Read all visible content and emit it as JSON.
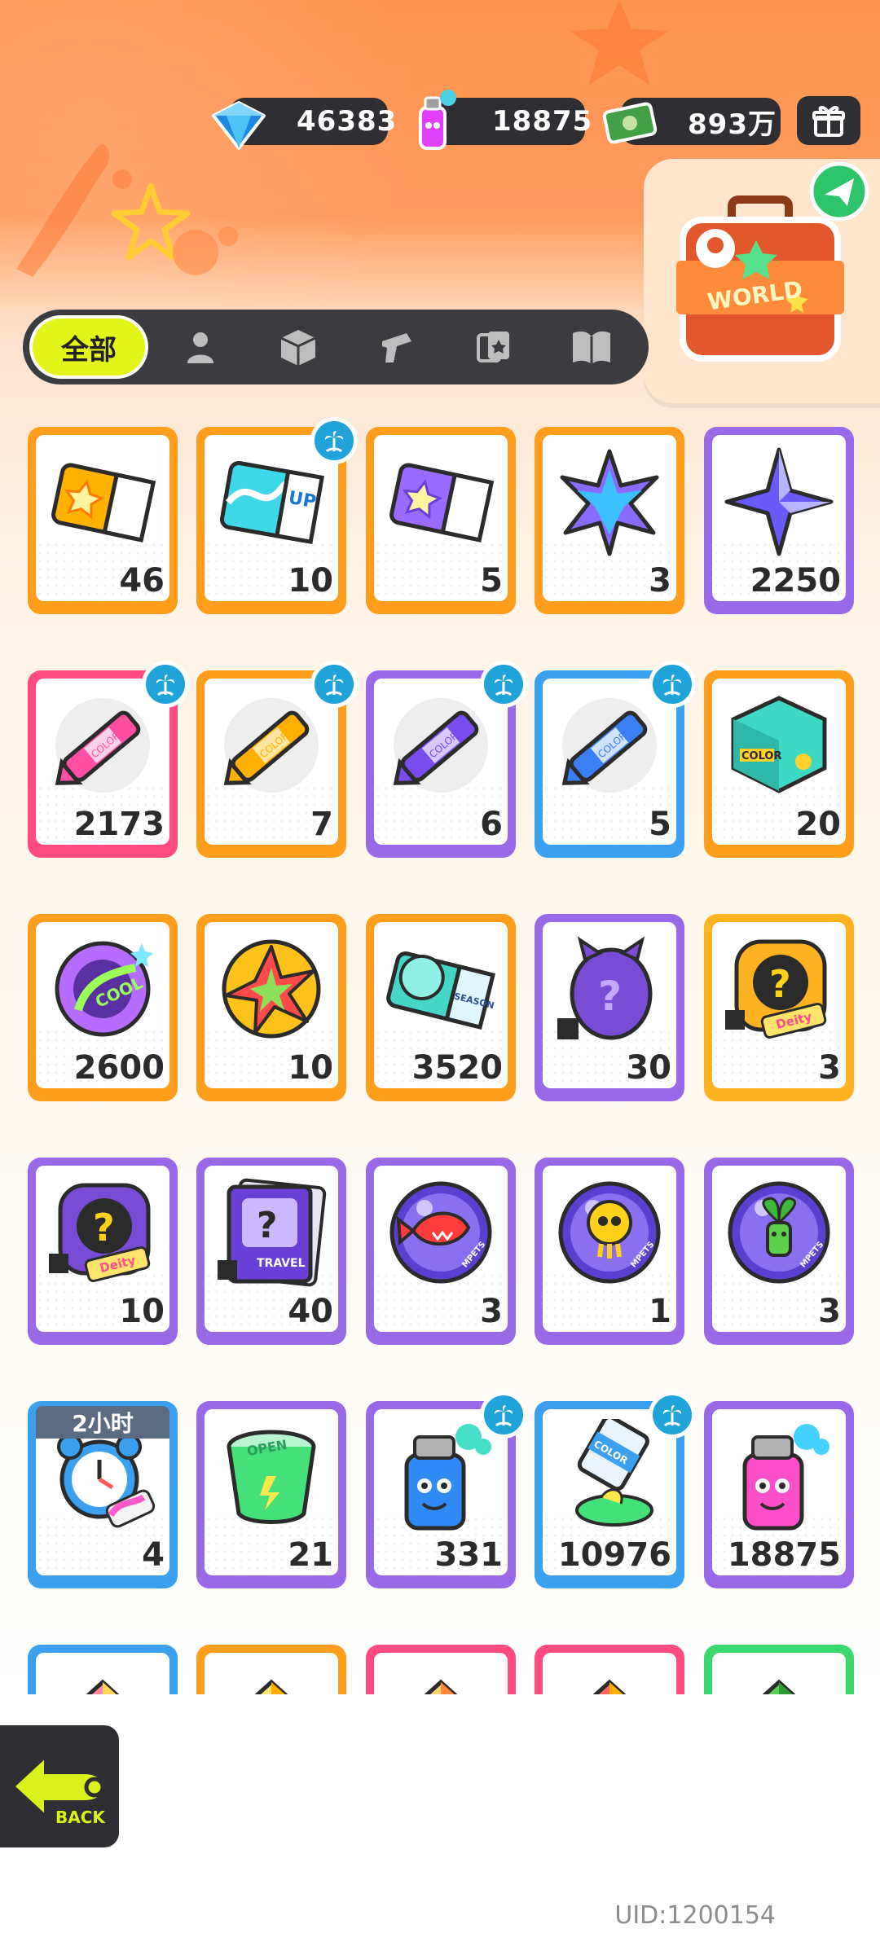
{
  "currencies": [
    {
      "id": "diamond",
      "icon": "diamond-icon",
      "value": "46383",
      "color": "#29b6f6"
    },
    {
      "id": "spray",
      "icon": "spray-can-icon",
      "value": "18875",
      "color": "#e040fb"
    },
    {
      "id": "cash",
      "icon": "cash-icon",
      "value": "893万",
      "color": "#4caf50"
    }
  ],
  "header": {
    "gift_icon": "gift-box-icon",
    "world_label": "WORLD"
  },
  "tabs": [
    {
      "label": "全部",
      "icon": "",
      "active": true
    },
    {
      "label": "",
      "icon": "person-icon"
    },
    {
      "label": "",
      "icon": "box-icon"
    },
    {
      "label": "",
      "icon": "spray-gun-icon"
    },
    {
      "label": "",
      "icon": "cards-icon"
    },
    {
      "label": "",
      "icon": "book-icon"
    }
  ],
  "items": [
    {
      "name": "yellow-ticket",
      "count": "46",
      "frame": "orange",
      "badge": false,
      "icon": "ticket-star-icon",
      "main": "#ffb300",
      "accent": "#ff7b00"
    },
    {
      "name": "wave-up-ticket",
      "count": "10",
      "frame": "orange",
      "badge": true,
      "icon": "ticket-wave-icon",
      "main": "#3fd8e8",
      "accent": "#1b77d2",
      "text": "UP"
    },
    {
      "name": "purple-ticket",
      "count": "5",
      "frame": "orange",
      "badge": false,
      "icon": "ticket-star-icon",
      "main": "#9b6bff",
      "accent": "#6a3fd6"
    },
    {
      "name": "rainbow-star",
      "count": "3",
      "frame": "orange",
      "badge": false,
      "icon": "rainbow-star-icon",
      "main": "#8a6bff",
      "accent": "#2bd4ff"
    },
    {
      "name": "purple-crystal",
      "count": "2250",
      "frame": "purple",
      "badge": false,
      "icon": "crystal-star-icon",
      "main": "#6a5af9",
      "accent": "#b8b4ff"
    },
    {
      "name": "pink-crayon",
      "count": "2173",
      "frame": "pink",
      "badge": true,
      "icon": "crayon-icon",
      "main": "#ff4fa3",
      "accent": "#ffd1e8",
      "text": "COLOR"
    },
    {
      "name": "yellow-crayon",
      "count": "7",
      "frame": "orange",
      "badge": true,
      "icon": "crayon-icon",
      "main": "#ffb000",
      "accent": "#ffe6a0",
      "text": "COLOR"
    },
    {
      "name": "purple-crayon",
      "count": "6",
      "frame": "purple",
      "badge": true,
      "icon": "crayon-icon",
      "main": "#7a4cf0",
      "accent": "#d9c8ff",
      "text": "COLOR"
    },
    {
      "name": "blue-crayon",
      "count": "5",
      "frame": "blue",
      "badge": true,
      "icon": "crayon-icon",
      "main": "#3b7ff5",
      "accent": "#cfe2ff",
      "text": "COLOR"
    },
    {
      "name": "color-cube",
      "count": "20",
      "frame": "orange",
      "badge": false,
      "icon": "color-cube-icon",
      "main": "#3fd8c4",
      "accent": "#ffd12a",
      "text": "COLOR"
    },
    {
      "name": "cool-badge",
      "count": "2600",
      "frame": "orange",
      "badge": false,
      "icon": "cool-badge-icon",
      "main": "#b56cff",
      "accent": "#9aff5b",
      "text": "COOL"
    },
    {
      "name": "burst-badge",
      "count": "10",
      "frame": "orange",
      "badge": false,
      "icon": "burst-badge-icon",
      "main": "#ffc21a",
      "accent": "#ff4a4a"
    },
    {
      "name": "season-ticket",
      "count": "3520",
      "frame": "orange",
      "badge": false,
      "icon": "season-ticket-icon",
      "main": "#45d6c8",
      "accent": "#2a4e9b",
      "text": "SEASON"
    },
    {
      "name": "mystery-egg",
      "count": "30",
      "frame": "purple",
      "badge": false,
      "icon": "mystery-egg-icon",
      "main": "#7a4cd6",
      "accent": "#c9a8ff"
    },
    {
      "name": "deity-mystery-gold",
      "count": "3",
      "frame": "gold",
      "badge": false,
      "icon": "mystery-card-icon",
      "main": "#ffb323",
      "accent": "#2b2b2b",
      "text": "Deity"
    },
    {
      "name": "deity-mystery-purple",
      "count": "10",
      "frame": "purple",
      "badge": false,
      "icon": "mystery-card-icon",
      "main": "#7a4cd6",
      "accent": "#2b2b2b",
      "text": "Deity"
    },
    {
      "name": "travel-card",
      "count": "40",
      "frame": "purple",
      "badge": false,
      "icon": "travel-card-icon",
      "main": "#6a3fd6",
      "accent": "#2b2b2b",
      "text": "TRAVEL"
    },
    {
      "name": "fish-orb",
      "count": "3",
      "frame": "purple",
      "badge": false,
      "icon": "fish-orb-icon",
      "main": "#5a3fd0",
      "accent": "#ff3b3b",
      "text": "MPETS"
    },
    {
      "name": "jelly-orb",
      "count": "1",
      "frame": "purple",
      "badge": false,
      "icon": "jelly-orb-icon",
      "main": "#5a3fd0",
      "accent": "#ffd21a",
      "text": "MPETS"
    },
    {
      "name": "sprout-orb",
      "count": "3",
      "frame": "purple",
      "badge": false,
      "icon": "sprout-orb-icon",
      "main": "#5a3fd0",
      "accent": "#5bd14b",
      "text": "MPETS"
    },
    {
      "name": "alarm-clock",
      "count": "4",
      "frame": "blue",
      "badge": false,
      "icon": "alarm-clock-icon",
      "main": "#3aa0ef",
      "accent": "#ff5a5a",
      "timer": "2小时"
    },
    {
      "name": "open-jelly-cup",
      "count": "21",
      "frame": "purple",
      "badge": false,
      "icon": "jelly-cup-icon",
      "main": "#45e07a",
      "accent": "#ffe94a",
      "text": "OPEN"
    },
    {
      "name": "blue-spray-can",
      "count": "331",
      "frame": "purple",
      "badge": true,
      "icon": "spray-can-icon",
      "main": "#2f8af5",
      "accent": "#46e0c9"
    },
    {
      "name": "paint-tube",
      "count": "10976",
      "frame": "blue",
      "badge": true,
      "icon": "paint-tube-icon",
      "main": "#3aa0ef",
      "accent": "#46e07a",
      "text": "COLOR"
    },
    {
      "name": "pink-spray-can",
      "count": "18875",
      "frame": "purple",
      "badge": false,
      "icon": "spray-can-icon",
      "main": "#ff4fc8",
      "accent": "#46d0ff"
    },
    {
      "name": "partial-item-1",
      "count": "",
      "frame": "blue",
      "badge": false,
      "icon": "partial-item-icon",
      "main": "#ff8aa8",
      "accent": "#ffd75a"
    },
    {
      "name": "partial-item-2",
      "count": "",
      "frame": "orange",
      "badge": false,
      "icon": "partial-item-icon",
      "main": "#ffe27a",
      "accent": "#ffb000"
    },
    {
      "name": "partial-item-3",
      "count": "",
      "frame": "pink",
      "badge": false,
      "icon": "partial-item-icon",
      "main": "#ffd07a",
      "accent": "#ff8a3a"
    },
    {
      "name": "partial-item-4",
      "count": "",
      "frame": "pink",
      "badge": false,
      "icon": "partial-item-icon",
      "main": "#ff6a5a",
      "accent": "#ffb000"
    },
    {
      "name": "partial-item-5",
      "count": "",
      "frame": "green",
      "badge": false,
      "icon": "partial-item-icon",
      "main": "#5bd14b",
      "accent": "#2e9c3a"
    }
  ],
  "back": {
    "label": "BACK",
    "icon": "back-arrow-icon"
  },
  "uid": "UID:1200154"
}
